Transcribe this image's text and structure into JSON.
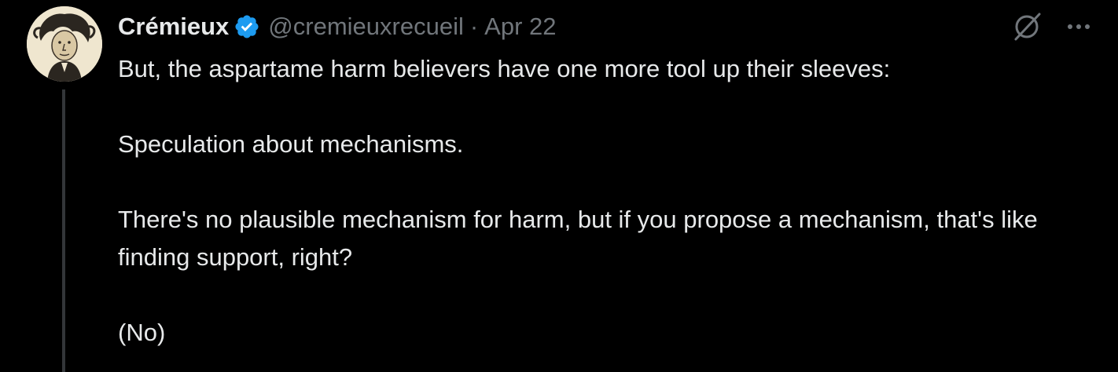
{
  "author": {
    "display_name": "Crémieux",
    "handle": "@cremieuxrecueil",
    "separator": "·",
    "date": "Apr 22",
    "verified": true,
    "verified_color": "#1d9bf0"
  },
  "icons": {
    "grok": "grok-icon",
    "more": "more-options-icon",
    "verified": "verified-badge-icon"
  },
  "tweet": {
    "paragraphs": [
      "But, the aspartame harm believers have one more tool up their sleeves:",
      "Speculation about mechanisms.",
      "There's no plausible mechanism for harm, but if you propose a mechanism, that's like finding support, right?",
      "(No)"
    ]
  },
  "colors": {
    "background": "#000000",
    "text": "#e7e9ea",
    "secondary_text": "#71767b",
    "thread_line": "#333639"
  }
}
